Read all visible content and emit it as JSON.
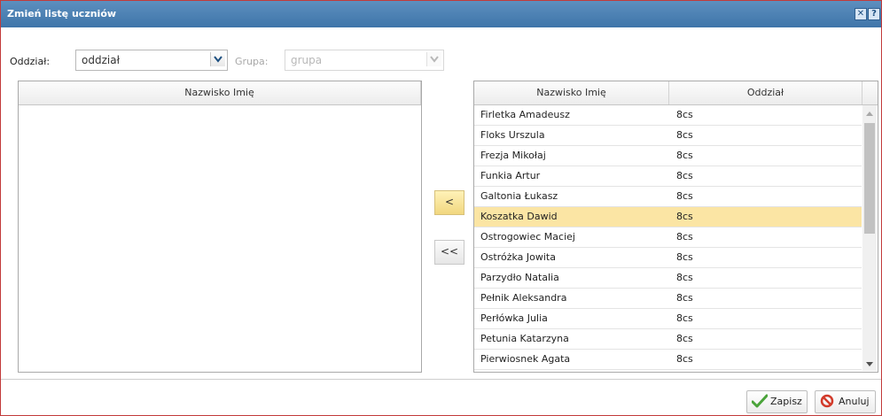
{
  "dialog": {
    "title": "Zmień listę uczniów",
    "close_icon": "close-icon",
    "help_icon": "help-icon"
  },
  "filters": {
    "oddzial_label": "Oddział:",
    "oddzial_value": "oddział",
    "grupa_label": "Grupa:",
    "grupa_value": "grupa"
  },
  "left_grid": {
    "header": "Nazwisko Imię",
    "rows": []
  },
  "move_buttons": {
    "move_one_label": "<",
    "move_all_label": "<<"
  },
  "right_grid": {
    "headers": [
      "Nazwisko Imię",
      "Oddział"
    ],
    "selected_row": "Koszatka Dawid",
    "rows": [
      {
        "name": "Firletka Amadeusz",
        "class": "8cs"
      },
      {
        "name": "Floks Urszula",
        "class": "8cs"
      },
      {
        "name": "Frezja Mikołaj",
        "class": "8cs"
      },
      {
        "name": "Funkia Artur",
        "class": "8cs"
      },
      {
        "name": "Galtonia Łukasz",
        "class": "8cs"
      },
      {
        "name": "Koszatka Dawid",
        "class": "8cs"
      },
      {
        "name": "Ostrogowiec Maciej",
        "class": "8cs"
      },
      {
        "name": "Ostróżka Jowita",
        "class": "8cs"
      },
      {
        "name": "Parzydło Natalia",
        "class": "8cs"
      },
      {
        "name": "Pełnik Aleksandra",
        "class": "8cs"
      },
      {
        "name": "Perłówka Julia",
        "class": "8cs"
      },
      {
        "name": "Petunia Katarzyna",
        "class": "8cs"
      },
      {
        "name": "Pierwiosnek Agata",
        "class": "8cs"
      }
    ]
  },
  "actions": {
    "save_label": "Zapisz",
    "cancel_label": "Anuluj"
  },
  "colors": {
    "title_bar": "#4a7fb3",
    "selected_row": "#fbe5a4",
    "dialog_border": "#c23a3a"
  }
}
